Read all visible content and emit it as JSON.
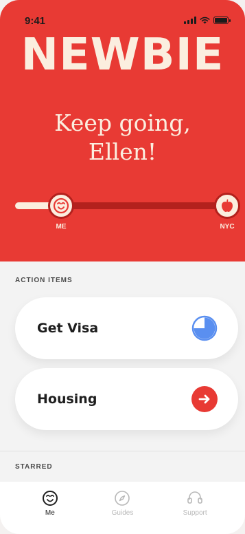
{
  "status_bar": {
    "time": "9:41"
  },
  "brand": {
    "name": "NEWBIE"
  },
  "hero": {
    "headline_line1": "Keep going,",
    "headline_line2": "Ellen!"
  },
  "progress": {
    "start_label": "ME",
    "end_label": "NYC",
    "fraction": 0.2
  },
  "sections": {
    "action_items_label": "ACTION ITEMS",
    "starred_label": "STARRED"
  },
  "action_items": [
    {
      "title": "Get Visa",
      "icon": "pie-progress-icon",
      "progress": 0.75
    },
    {
      "title": "Housing",
      "icon": "arrow-right-circle-icon"
    }
  ],
  "tabbar": [
    {
      "label": "Me",
      "icon": "smiley-icon",
      "active": true
    },
    {
      "label": "Guides",
      "icon": "compass-icon",
      "active": false
    },
    {
      "label": "Support",
      "icon": "headset-icon",
      "active": false
    }
  ],
  "colors": {
    "brand_red": "#e83a34",
    "dark_red": "#b3211d",
    "cream": "#fbeedf",
    "visa_blue": "#5a8ff0"
  }
}
